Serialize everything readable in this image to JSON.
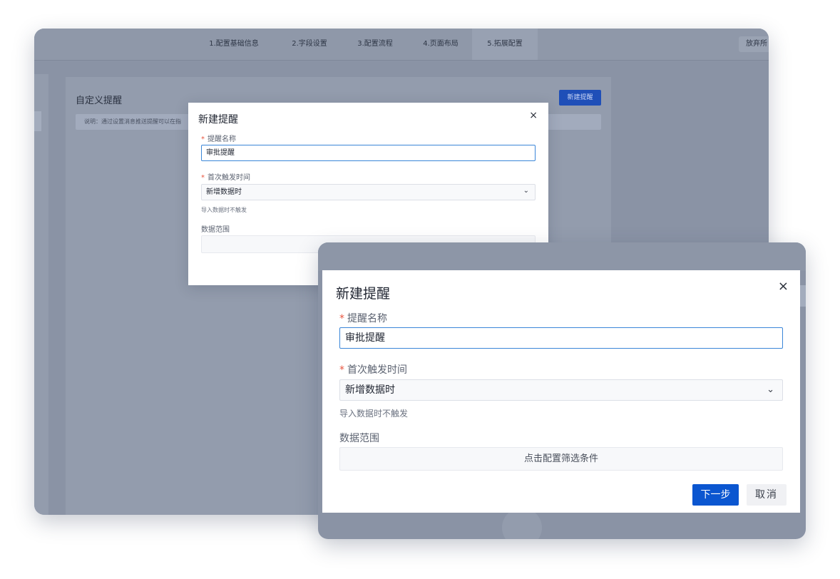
{
  "back_window": {
    "steps": [
      {
        "label": "1.配置基础信息"
      },
      {
        "label": "2.字段设置"
      },
      {
        "label": "3.配置流程"
      },
      {
        "label": "4.页面布局"
      },
      {
        "label": "5.拓展配置"
      }
    ],
    "active_step": "5.拓展配置",
    "discard_label": "放弃所",
    "panel_title": "自定义提醒",
    "notice_text": "说明：通过设置消息推送提醒可以在指",
    "new_reminder_label": "新建提醒"
  },
  "dialog": {
    "title": "新建提醒",
    "close_glyph": "×",
    "required_mark": "*",
    "name_label": "提醒名称",
    "name_value": "审批提醒",
    "trigger_label": "首次触发时间",
    "trigger_value": "新增数据时",
    "trigger_chevron": "⌄",
    "hint": "导入数据时不触发",
    "range_label": "数据范围",
    "filter_button": "点击配置筛选条件",
    "next_label": "下一步",
    "cancel_label": "取消"
  },
  "colors": {
    "primary": "#0b56d0",
    "required": "#e8553f",
    "input_focus_border": "#3a86d8",
    "overlay": "#8a93a5"
  }
}
